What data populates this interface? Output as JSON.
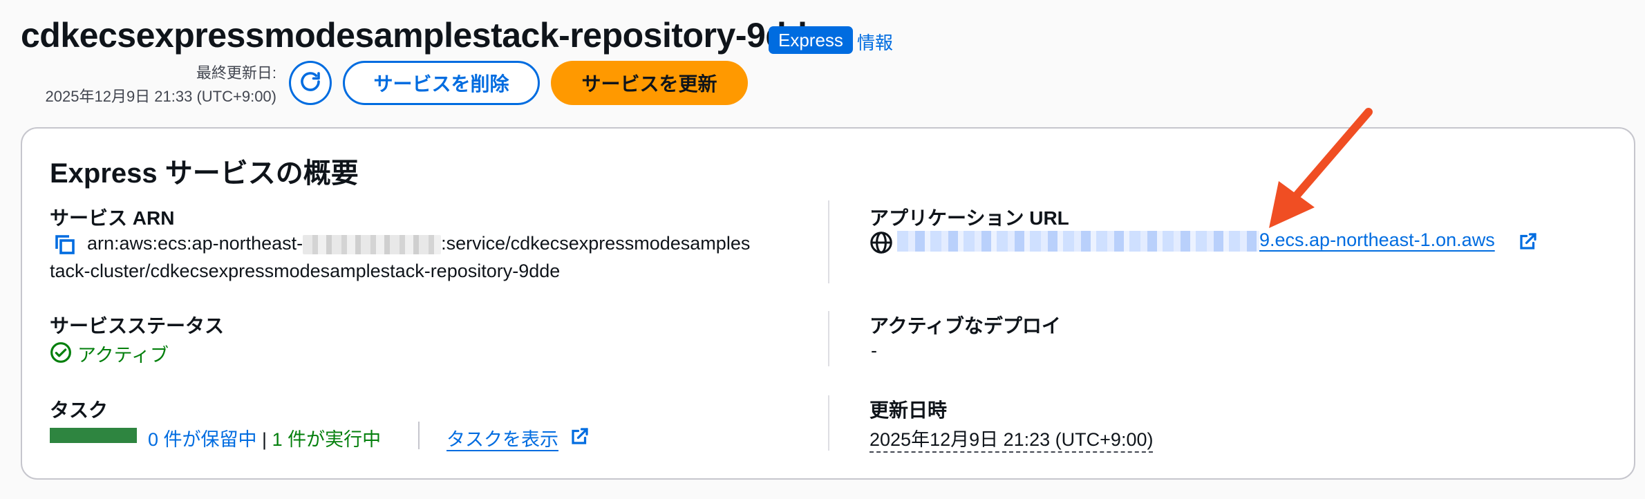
{
  "header": {
    "title": "cdkecsexpressmodesamplestack-repository-9dde",
    "badge": "Express",
    "info_link": "情報",
    "last_updated_label": "最終更新日:",
    "last_updated_value": "2025年12月9日 21:33 (UTC+9:00)",
    "delete_button": "サービスを削除",
    "update_button": "サービスを更新"
  },
  "overview": {
    "title": "Express サービスの概要",
    "service_arn": {
      "label": "サービス ARN",
      "value_prefix": "arn:aws:ecs:ap-northeast-",
      "value_suffix": ":service/cdkecsexpressmodesamples",
      "value_line2": "tack-cluster/cdkecsexpressmodesamplestack-repository-9dde"
    },
    "application_url": {
      "label": "アプリケーション URL",
      "value_suffix": "9.ecs.ap-northeast-1.on.aws"
    },
    "service_status": {
      "label": "サービスステータス",
      "value": "アクティブ"
    },
    "active_deployment": {
      "label": "アクティブなデプロイ",
      "value": "-"
    },
    "tasks": {
      "label": "タスク",
      "pending": "0 件が保留中",
      "separator": "|",
      "running": "1 件が実行中",
      "view_link": "タスクを表示",
      "running_fraction": 1.0
    },
    "updated_at": {
      "label": "更新日時",
      "value": "2025年12月9日 21:23 (UTC+9:00)"
    }
  },
  "colors": {
    "accent": "#006ce0",
    "primary_button": "#ff9900",
    "success": "#037f0c",
    "annotation_arrow": "#f04e23"
  },
  "icons": [
    "refresh-icon",
    "copy-icon",
    "globe-icon",
    "external-link-icon",
    "status-check-icon",
    "annotation-arrow-icon"
  ]
}
